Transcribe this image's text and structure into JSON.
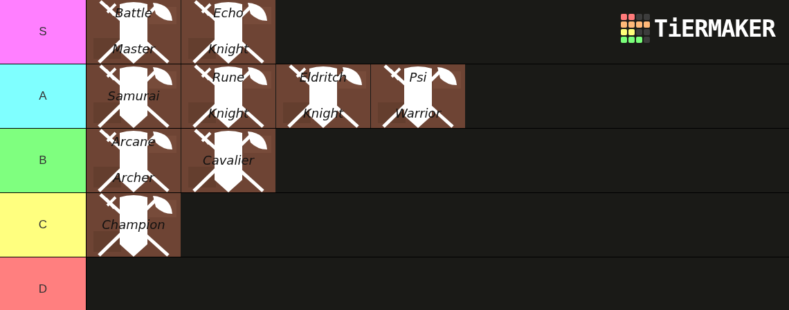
{
  "logo": {
    "text": "TiERMAKER"
  },
  "tiers": [
    {
      "label": "S",
      "color": "#ff7fff",
      "items": [
        {
          "lines": [
            "Battle",
            "Master"
          ]
        },
        {
          "lines": [
            "Echo",
            "Knight"
          ]
        }
      ]
    },
    {
      "label": "A",
      "color": "#7fffff",
      "items": [
        {
          "lines": [
            "Samurai"
          ]
        },
        {
          "lines": [
            "Rune",
            "Knight"
          ]
        },
        {
          "lines": [
            "Eldritch",
            "Knight"
          ]
        },
        {
          "lines": [
            "Psi",
            "Warrior"
          ]
        }
      ]
    },
    {
      "label": "B",
      "color": "#7fff7f",
      "items": [
        {
          "lines": [
            "Arcane",
            "Archer"
          ]
        },
        {
          "lines": [
            "Cavalier"
          ]
        }
      ]
    },
    {
      "label": "C",
      "color": "#ffff7f",
      "items": [
        {
          "lines": [
            "Champion"
          ]
        }
      ]
    },
    {
      "label": "D",
      "color": "#ff7f7f"
    }
  ]
}
